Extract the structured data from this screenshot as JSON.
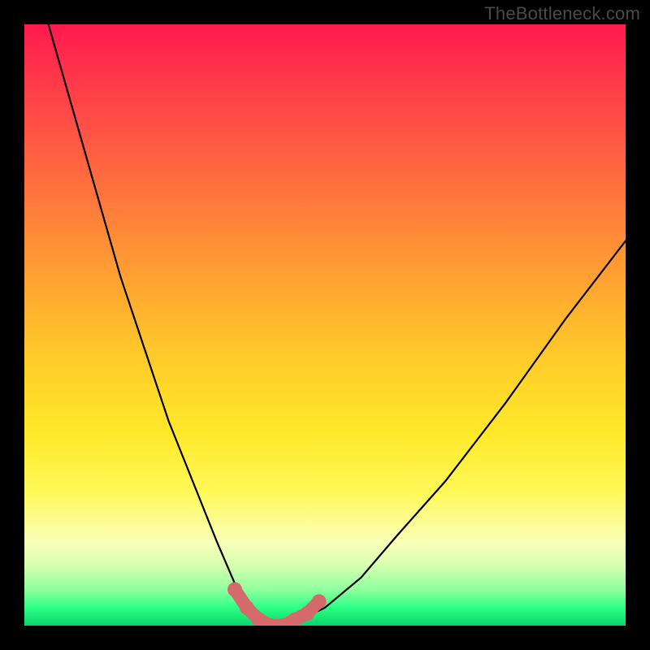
{
  "watermark": "TheBottleneck.com",
  "chart_data": {
    "type": "line",
    "title": "",
    "xlabel": "",
    "ylabel": "",
    "xlim": [
      0,
      100
    ],
    "ylim": [
      0,
      100
    ],
    "note": "No axis tick labels shown; values estimated from curve geometry.",
    "series": [
      {
        "name": "bottleneck-curve",
        "x": [
          4,
          8,
          12,
          16,
          20,
          24,
          28,
          32,
          35,
          38,
          40,
          42,
          44,
          46,
          50,
          56,
          62,
          70,
          80,
          90,
          100
        ],
        "y": [
          100,
          86,
          72,
          58,
          46,
          34,
          24,
          14,
          7,
          3,
          1,
          0,
          0,
          1,
          3,
          8,
          15,
          24,
          37,
          51,
          64
        ]
      }
    ],
    "highlight": {
      "name": "trough-marker",
      "color": "#d46a6a",
      "x": [
        35,
        37,
        39,
        41,
        43,
        45,
        47,
        49
      ],
      "y": [
        6,
        3,
        1,
        0,
        0,
        1,
        2,
        4
      ]
    },
    "background_gradient": {
      "top": "#ff1a4d",
      "mid": "#ffe92a",
      "bottom": "#08d66a"
    }
  }
}
